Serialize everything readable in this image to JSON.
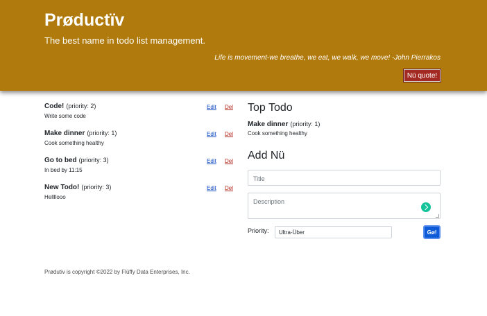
{
  "header": {
    "brand": "Prøductïv",
    "tagline": "The best name in todo list management.",
    "quote": "Life is movement-we breathe, we eat, we walk, we move! -John Pierrakos",
    "quote_button": "Nü quote!",
    "background_color": "#b07b0c"
  },
  "todos": [
    {
      "title": "Code!",
      "priority": "(priority: 2)",
      "description": "Write some code",
      "edit": "Edit",
      "del": "Del"
    },
    {
      "title": "Make dinner",
      "priority": "(priority: 1)",
      "description": "Cook something healthy",
      "edit": "Edit",
      "del": "Del"
    },
    {
      "title": "Go to bed",
      "priority": "(priority: 3)",
      "description": "In bed by 11:15",
      "edit": "Edit",
      "del": "Del"
    },
    {
      "title": "New Todo!",
      "priority": "(priority: 3)",
      "description": "Hellllooo",
      "edit": "Edit",
      "del": "Del"
    }
  ],
  "top_todo": {
    "heading": "Top Todo",
    "title": "Make dinner",
    "priority": "(priority: 1)",
    "description": "Cook something healthy"
  },
  "add_form": {
    "heading": "Add Nü",
    "title_placeholder": "Title",
    "description_placeholder": "Description",
    "priority_label": "Priority:",
    "priority_value": "Ultra-Über",
    "submit_label": "Gø!"
  },
  "footer": {
    "text": "Prødutiv is copyright ©2022 by Flüffy Data Enterprises, Inc."
  }
}
